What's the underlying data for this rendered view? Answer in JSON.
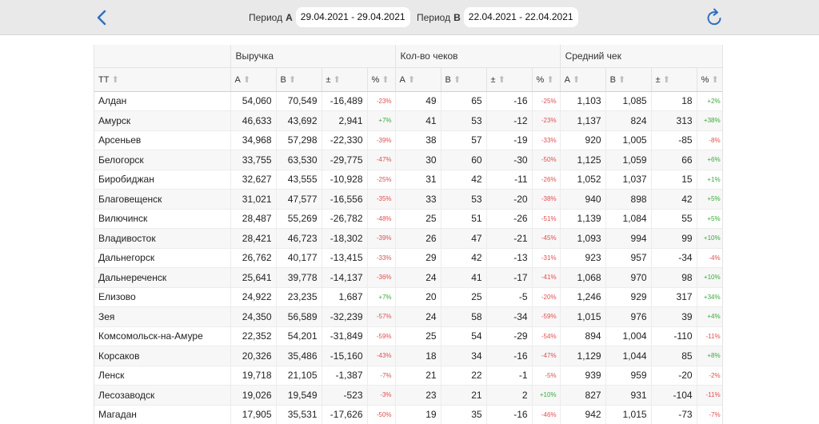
{
  "periods": {
    "a": {
      "label": "Период",
      "letter": "A",
      "dates": "29.04.2021 - 29.04.2021"
    },
    "b": {
      "label": "Период",
      "letter": "B",
      "dates": "22.04.2021 - 22.04.2021"
    }
  },
  "icons": {
    "back": "chevron-left-icon",
    "refresh": "refresh-icon",
    "sort": "sort-arrow-up-icon"
  },
  "colors": {
    "accent": "#2f6fbf",
    "negative": "#e05050",
    "positive": "#3aaa3a"
  },
  "table": {
    "groups": {
      "revenue": "Выручка",
      "checks": "Кол-во чеков",
      "avg": "Средний чек"
    },
    "columns": {
      "tt": "ТТ",
      "a": "A",
      "b": "B",
      "diff": "±",
      "pct": "%"
    },
    "rows": [
      {
        "name": "Алдан",
        "values": [
          "54,060",
          "70,549",
          "-16,489",
          "-23%",
          "49",
          "65",
          "-16",
          "-25%",
          "1,103",
          "1,085",
          "18",
          "+2%"
        ]
      },
      {
        "name": "Амурск",
        "values": [
          "46,633",
          "43,692",
          "2,941",
          "+7%",
          "41",
          "53",
          "-12",
          "-23%",
          "1,137",
          "824",
          "313",
          "+38%"
        ]
      },
      {
        "name": "Арсеньев",
        "values": [
          "34,968",
          "57,298",
          "-22,330",
          "-39%",
          "38",
          "57",
          "-19",
          "-33%",
          "920",
          "1,005",
          "-85",
          "-8%"
        ]
      },
      {
        "name": "Белогорск",
        "values": [
          "33,755",
          "63,530",
          "-29,775",
          "-47%",
          "30",
          "60",
          "-30",
          "-50%",
          "1,125",
          "1,059",
          "66",
          "+6%"
        ]
      },
      {
        "name": "Биробиджан",
        "values": [
          "32,627",
          "43,555",
          "-10,928",
          "-25%",
          "31",
          "42",
          "-11",
          "-26%",
          "1,052",
          "1,037",
          "15",
          "+1%"
        ]
      },
      {
        "name": "Благовещенск",
        "values": [
          "31,021",
          "47,577",
          "-16,556",
          "-35%",
          "33",
          "53",
          "-20",
          "-38%",
          "940",
          "898",
          "42",
          "+5%"
        ]
      },
      {
        "name": "Вилючинск",
        "values": [
          "28,487",
          "55,269",
          "-26,782",
          "-48%",
          "25",
          "51",
          "-26",
          "-51%",
          "1,139",
          "1,084",
          "55",
          "+5%"
        ]
      },
      {
        "name": "Владивосток",
        "values": [
          "28,421",
          "46,723",
          "-18,302",
          "-39%",
          "26",
          "47",
          "-21",
          "-45%",
          "1,093",
          "994",
          "99",
          "+10%"
        ]
      },
      {
        "name": "Дальнегорск",
        "values": [
          "26,762",
          "40,177",
          "-13,415",
          "-33%",
          "29",
          "42",
          "-13",
          "-31%",
          "923",
          "957",
          "-34",
          "-4%"
        ]
      },
      {
        "name": "Дальнереченск",
        "values": [
          "25,641",
          "39,778",
          "-14,137",
          "-36%",
          "24",
          "41",
          "-17",
          "-41%",
          "1,068",
          "970",
          "98",
          "+10%"
        ]
      },
      {
        "name": "Елизово",
        "values": [
          "24,922",
          "23,235",
          "1,687",
          "+7%",
          "20",
          "25",
          "-5",
          "-20%",
          "1,246",
          "929",
          "317",
          "+34%"
        ]
      },
      {
        "name": "Зея",
        "values": [
          "24,350",
          "56,589",
          "-32,239",
          "-57%",
          "24",
          "58",
          "-34",
          "-59%",
          "1,015",
          "976",
          "39",
          "+4%"
        ]
      },
      {
        "name": "Комсомольск-на-Амуре",
        "values": [
          "22,352",
          "54,201",
          "-31,849",
          "-59%",
          "25",
          "54",
          "-29",
          "-54%",
          "894",
          "1,004",
          "-110",
          "-11%"
        ]
      },
      {
        "name": "Корсаков",
        "values": [
          "20,326",
          "35,486",
          "-15,160",
          "-43%",
          "18",
          "34",
          "-16",
          "-47%",
          "1,129",
          "1,044",
          "85",
          "+8%"
        ]
      },
      {
        "name": "Ленск",
        "values": [
          "19,718",
          "21,105",
          "-1,387",
          "-7%",
          "21",
          "22",
          "-1",
          "-5%",
          "939",
          "959",
          "-20",
          "-2%"
        ]
      },
      {
        "name": "Лесозаводск",
        "values": [
          "19,026",
          "19,549",
          "-523",
          "-3%",
          "23",
          "21",
          "2",
          "+10%",
          "827",
          "931",
          "-104",
          "-11%"
        ]
      },
      {
        "name": "Магадан",
        "values": [
          "17,905",
          "35,531",
          "-17,626",
          "-50%",
          "19",
          "35",
          "-16",
          "-46%",
          "942",
          "1,015",
          "-73",
          "-7%"
        ]
      }
    ]
  }
}
